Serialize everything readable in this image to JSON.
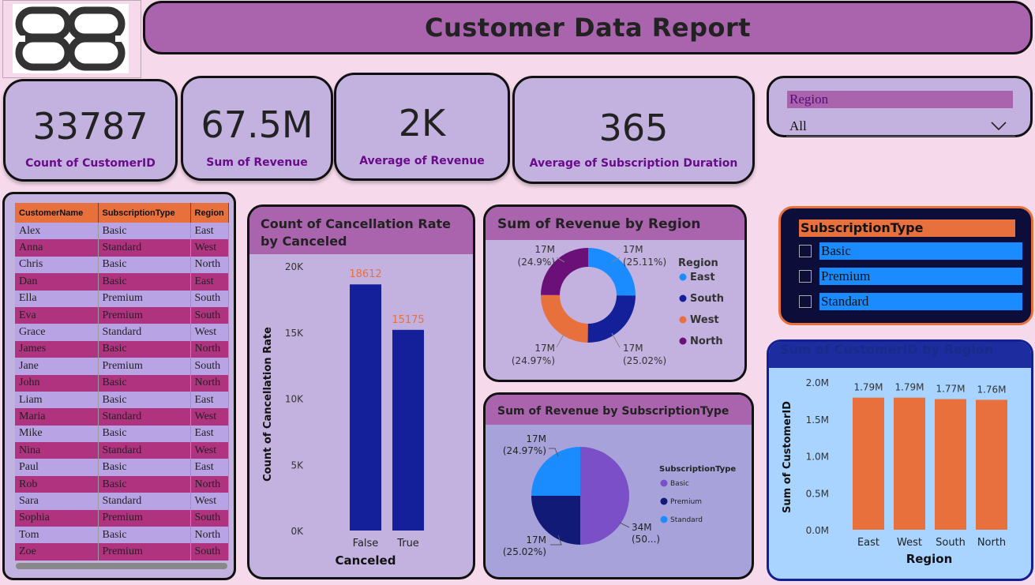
{
  "header": {
    "title": "Customer Data Report"
  },
  "kpis": [
    {
      "value": "33787",
      "label": "Count of CustomerID"
    },
    {
      "value": "67.5M",
      "label": "Sum of Revenue"
    },
    {
      "value": "2K",
      "label": "Average of Revenue"
    },
    {
      "value": "365",
      "label": "Average of Subscription Duration"
    }
  ],
  "region_slicer": {
    "header": "Region",
    "selected": "All"
  },
  "table": {
    "columns": [
      "CustomerName",
      "SubscriptionType",
      "Region"
    ],
    "rows": [
      [
        "Alex",
        "Basic",
        "East"
      ],
      [
        "Anna",
        "Standard",
        "West"
      ],
      [
        "Chris",
        "Basic",
        "North"
      ],
      [
        "Dan",
        "Basic",
        "East"
      ],
      [
        "Ella",
        "Premium",
        "South"
      ],
      [
        "Eva",
        "Premium",
        "South"
      ],
      [
        "Grace",
        "Standard",
        "West"
      ],
      [
        "James",
        "Basic",
        "North"
      ],
      [
        "Jane",
        "Premium",
        "South"
      ],
      [
        "John",
        "Basic",
        "North"
      ],
      [
        "Liam",
        "Basic",
        "East"
      ],
      [
        "Maria",
        "Standard",
        "West"
      ],
      [
        "Mike",
        "Basic",
        "East"
      ],
      [
        "Nina",
        "Standard",
        "West"
      ],
      [
        "Paul",
        "Basic",
        "East"
      ],
      [
        "Rob",
        "Basic",
        "North"
      ],
      [
        "Sara",
        "Standard",
        "West"
      ],
      [
        "Sophia",
        "Premium",
        "South"
      ],
      [
        "Tom",
        "Basic",
        "North"
      ],
      [
        "Zoe",
        "Premium",
        "South"
      ]
    ]
  },
  "subscription_slicer": {
    "header": "SubscriptionType",
    "items": [
      "Basic",
      "Premium",
      "Standard"
    ]
  },
  "colors": {
    "accent": "#a964ad",
    "orange": "#e8703c",
    "navy": "#13209a",
    "blue": "#1a8cff",
    "purple": "#6a1f7a"
  },
  "chart_data": [
    {
      "type": "bar",
      "title": "Count of Cancellation Rate by Canceled",
      "xlabel": "Canceled",
      "ylabel": "Count of Cancellation Rate",
      "categories": [
        "False",
        "True"
      ],
      "values": [
        18612,
        15175
      ],
      "ylim": [
        0,
        20000
      ],
      "yticks": [
        "0K",
        "5K",
        "10K",
        "15K",
        "20K"
      ],
      "data_labels": [
        "18612",
        "15175"
      ]
    },
    {
      "type": "pie",
      "subtype": "donut",
      "title": "Sum of Revenue by Region",
      "legend_title": "Region",
      "categories": [
        "East",
        "South",
        "West",
        "North"
      ],
      "values": [
        16.95,
        16.89,
        16.86,
        16.81
      ],
      "labels": [
        [
          "17M",
          "(25.11%)"
        ],
        [
          "17M",
          "(25.02%)"
        ],
        [
          "17M",
          "(24.97%)"
        ],
        [
          "17M",
          "(24.9%)"
        ]
      ],
      "colors": [
        "#1a8cff",
        "#13209a",
        "#e8703c",
        "#6a1078"
      ]
    },
    {
      "type": "pie",
      "title": "Sum of Revenue by SubscriptionType",
      "legend_title": "SubscriptionType",
      "categories": [
        "Basic",
        "Premium",
        "Standard"
      ],
      "values": [
        34,
        17,
        17
      ],
      "labels": [
        [
          "34M",
          "(50...)"
        ],
        [
          "17M",
          "(25.02%)"
        ],
        [
          "17M",
          "(24.97%)"
        ]
      ],
      "colors": [
        "#7a4fc8",
        "#121a78",
        "#1a8cff"
      ]
    },
    {
      "type": "bar",
      "title": "Sum of CustomerID by Region",
      "xlabel": "Region",
      "ylabel": "Sum of CustomerID",
      "categories": [
        "East",
        "West",
        "South",
        "North"
      ],
      "values": [
        1.79,
        1.79,
        1.77,
        1.76
      ],
      "data_labels": [
        "1.79M",
        "1.79M",
        "1.77M",
        "1.76M"
      ],
      "ylim": [
        0,
        2.0
      ],
      "yticks": [
        "0.0M",
        "0.5M",
        "1.0M",
        "1.5M",
        "2.0M"
      ]
    }
  ]
}
